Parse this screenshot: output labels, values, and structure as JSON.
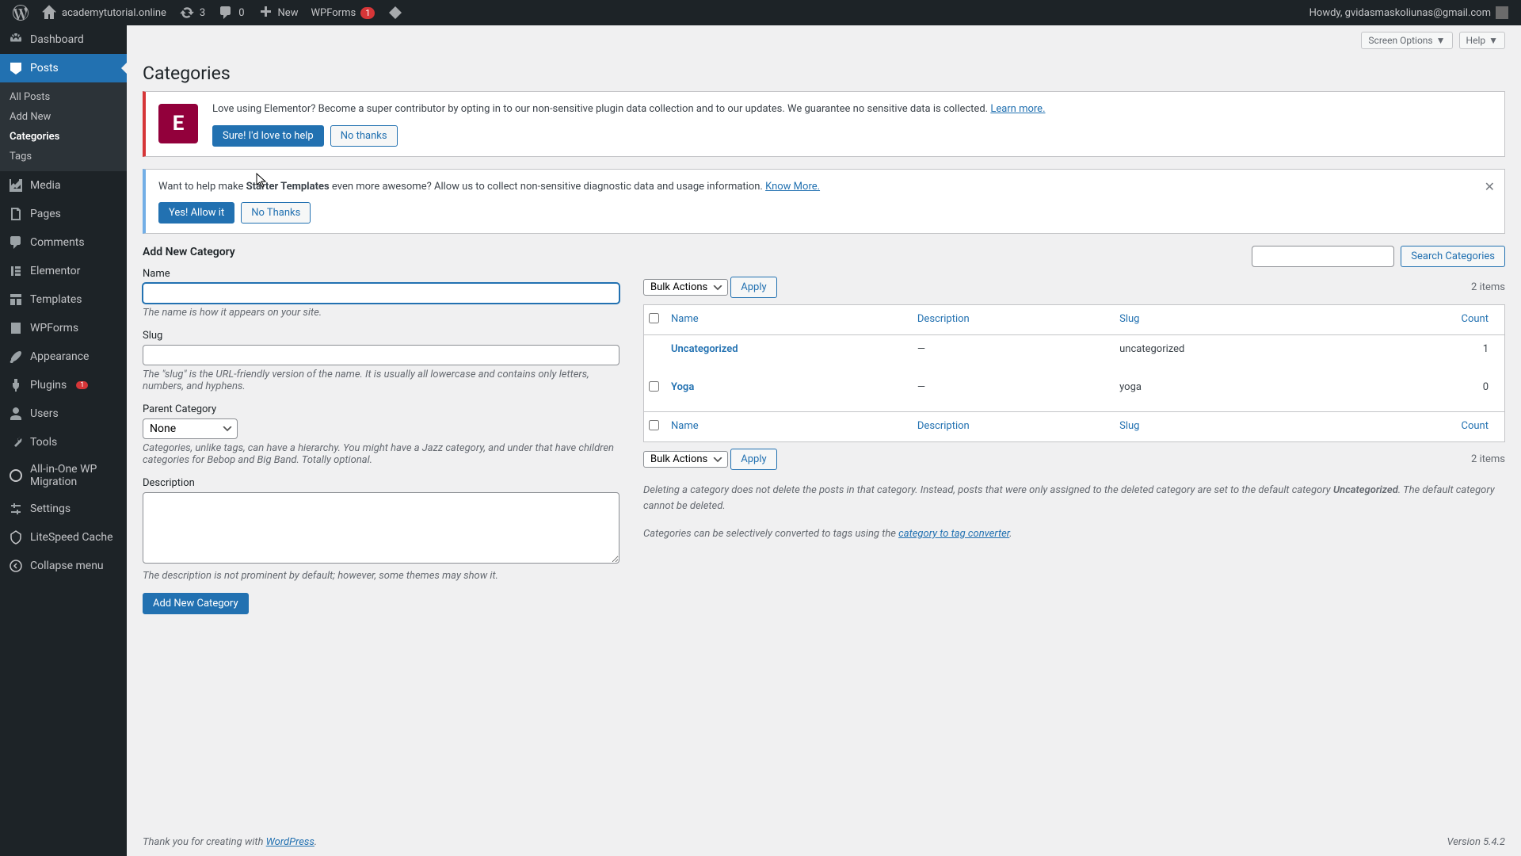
{
  "adminbar": {
    "site": "academytutorial.online",
    "updates": "3",
    "comments": "0",
    "new": "New",
    "wpforms": "WPForms",
    "wpforms_badge": "1",
    "howdy": "Howdy, gvidasmaskoliunas@gmail.com"
  },
  "sidebar": {
    "dashboard": "Dashboard",
    "posts": "Posts",
    "posts_sub": {
      "all": "All Posts",
      "add": "Add New",
      "cats": "Categories",
      "tags": "Tags"
    },
    "media": "Media",
    "pages": "Pages",
    "comments": "Comments",
    "elementor": "Elementor",
    "templates": "Templates",
    "wpforms": "WPForms",
    "appearance": "Appearance",
    "plugins": "Plugins",
    "plugins_badge": "1",
    "users": "Users",
    "tools": "Tools",
    "migration": "All-in-One WP Migration",
    "settings": "Settings",
    "litespeed": "LiteSpeed Cache",
    "collapse": "Collapse menu"
  },
  "header": {
    "title": "Categories",
    "screen_options": "Screen Options",
    "help": "Help"
  },
  "notice1": {
    "text": "Love using Elementor? Become a super contributor by opting in to our non-sensitive plugin data collection and to our updates. We guarantee no sensitive data is collected. ",
    "link": "Learn more.",
    "btn1": "Sure! I'd love to help",
    "btn2": "No thanks"
  },
  "notice2": {
    "text_pre": "Want to help make ",
    "text_bold": "Starter Templates",
    "text_post": " even more awesome? Allow us to collect non-sensitive diagnostic data and usage information. ",
    "link": "Know More.",
    "btn1": "Yes! Allow it",
    "btn2": "No Thanks"
  },
  "form": {
    "heading": "Add New Category",
    "name_label": "Name",
    "name_help": "The name is how it appears on your site.",
    "slug_label": "Slug",
    "slug_help": "The \"slug\" is the URL-friendly version of the name. It is usually all lowercase and contains only letters, numbers, and hyphens.",
    "parent_label": "Parent Category",
    "parent_value": "None",
    "parent_help": "Categories, unlike tags, can have a hierarchy. You might have a Jazz category, and under that have children categories for Bebop and Big Band. Totally optional.",
    "desc_label": "Description",
    "desc_help": "The description is not prominent by default; however, some themes may show it.",
    "submit": "Add New Category"
  },
  "list": {
    "search_btn": "Search Categories",
    "bulk": "Bulk Actions",
    "apply": "Apply",
    "items": "2 items",
    "cols": {
      "name": "Name",
      "desc": "Description",
      "slug": "Slug",
      "count": "Count"
    },
    "rows": [
      {
        "name": "Uncategorized",
        "desc": "—",
        "slug": "uncategorized",
        "count": "1"
      },
      {
        "name": "Yoga",
        "desc": "—",
        "slug": "yoga",
        "count": "0"
      }
    ],
    "note1_pre": "Deleting a category does not delete the posts in that category. Instead, posts that were only assigned to the deleted category are set to the default category ",
    "note1_bold": "Uncategorized",
    "note1_post": ". The default category cannot be deleted.",
    "note2_pre": "Categories can be selectively converted to tags using the ",
    "note2_link": "category to tag converter"
  },
  "footer": {
    "thank_pre": "Thank you for creating with ",
    "thank_link": "WordPress",
    "version": "Version 5.4.2"
  }
}
